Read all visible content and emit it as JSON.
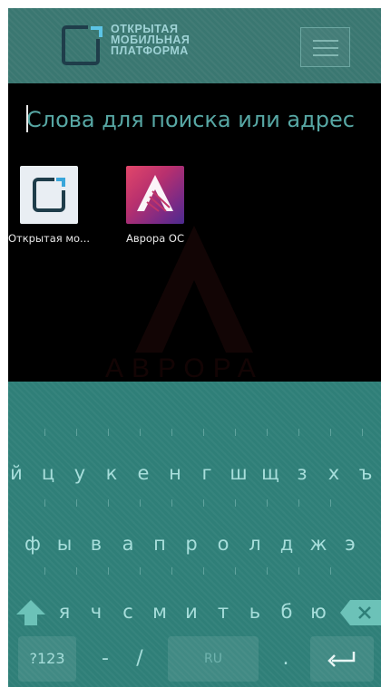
{
  "header": {
    "logo_lines": [
      "ОТКРЫТАЯ",
      "МОБИЛЬНАЯ",
      "ПЛАТФОРМА"
    ],
    "menu_icon": "hamburger-menu-icon"
  },
  "search": {
    "placeholder": "Слова для поиска или адрес",
    "value": ""
  },
  "apps": [
    {
      "label": "Открытая мо...",
      "icon": "omp-logo-icon"
    },
    {
      "label": "Аврора ОС",
      "icon": "aurora-logo-icon"
    }
  ],
  "watermark": {
    "text": "АВРОРА"
  },
  "keyboard": {
    "row1": [
      "й",
      "ц",
      "у",
      "к",
      "е",
      "н",
      "г",
      "ш",
      "щ",
      "з",
      "х",
      "ъ"
    ],
    "row2": [
      "ф",
      "ы",
      "в",
      "а",
      "п",
      "р",
      "о",
      "л",
      "д",
      "ж",
      "э"
    ],
    "row3": [
      "я",
      "ч",
      "с",
      "м",
      "и",
      "т",
      "ь",
      "б",
      "ю"
    ],
    "symbols_label": "?123",
    "dash_label": "-",
    "slash_label": "/",
    "space_label": "RU",
    "dot_label": ".",
    "shift_icon": "shift-arrow-icon",
    "backspace_icon": "backspace-icon",
    "enter_icon": "enter-return-icon"
  }
}
